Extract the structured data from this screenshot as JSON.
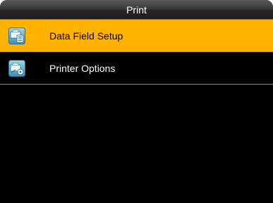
{
  "header": {
    "title": "Print"
  },
  "menu": {
    "items": [
      {
        "label": "Data Field Setup",
        "icon": "data-field-setup-icon",
        "selected": true
      },
      {
        "label": "Printer Options",
        "icon": "printer-options-icon",
        "selected": false
      }
    ]
  },
  "colors": {
    "selected_background": "#ffb300",
    "screen_background": "#000000",
    "icon_tile": "#4fa3c7"
  }
}
